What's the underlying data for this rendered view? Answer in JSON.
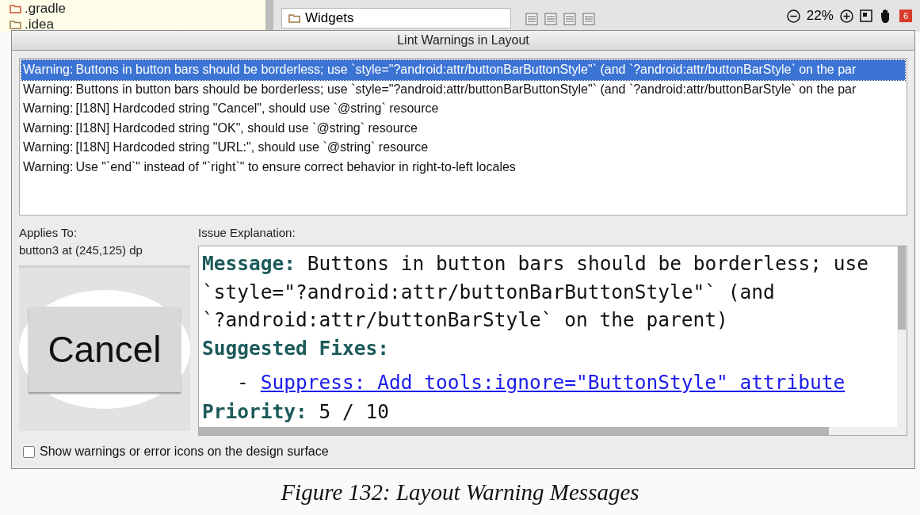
{
  "ide": {
    "project_items": [
      {
        "label": ".gradle"
      },
      {
        "label": ".idea"
      }
    ],
    "breadcrumb": "Widgets",
    "zoom": "22%",
    "badge": "6"
  },
  "dialog": {
    "title": "Lint Warnings in Layout",
    "warnings": [
      {
        "severity": "Warning:",
        "message": "Buttons in button bars should be borderless; use `style=\"?android:attr/buttonBarButtonStyle\"` (and `?android:attr/buttonBarStyle` on the par",
        "selected": true
      },
      {
        "severity": "Warning:",
        "message": "Buttons in button bars should be borderless; use `style=\"?android:attr/buttonBarButtonStyle\"` (and `?android:attr/buttonBarStyle` on the par",
        "selected": false
      },
      {
        "severity": "Warning:",
        "message": "[I18N] Hardcoded string \"Cancel\", should use `@string` resource",
        "selected": false
      },
      {
        "severity": "Warning:",
        "message": "[I18N] Hardcoded string \"OK\", should use `@string` resource",
        "selected": false
      },
      {
        "severity": "Warning:",
        "message": "[I18N] Hardcoded string \"URL:\", should use `@string` resource",
        "selected": false
      },
      {
        "severity": "Warning:",
        "message": "Use \"`end`\" instead of \"`right`\" to ensure correct behavior in right-to-left locales",
        "selected": false
      }
    ],
    "applies_to": {
      "label": "Applies To:",
      "value": "button3 at (245,125) dp",
      "preview_button": "Cancel"
    },
    "explanation": {
      "label": "Issue Explanation:",
      "message_label": "Message:",
      "message": "Buttons in button bars should be borderless; use `style=\"?android:attr/buttonBarButtonStyle\"` (and `?android:attr/buttonBarStyle` on the parent)",
      "fixes_label": "Suggested Fixes:",
      "fixes": [
        {
          "bullet": "-",
          "link": "Suppress: Add tools:ignore=\"ButtonStyle\" attribute"
        }
      ],
      "priority_label": "Priority:",
      "priority": "5 / 10"
    },
    "checkbox": {
      "label": "Show warnings or error icons on the design surface",
      "checked": false
    }
  },
  "caption": "Figure 132: Layout Warning Messages"
}
